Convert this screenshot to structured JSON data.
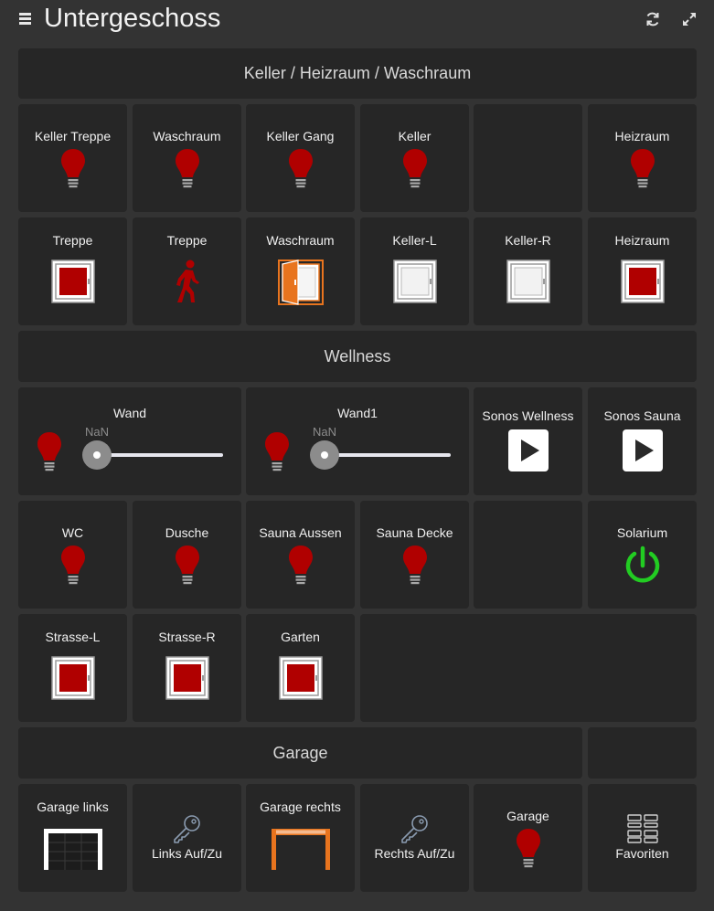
{
  "header": {
    "title": "Untergeschoss",
    "menu_icon": "hamburger-menu-icon",
    "refresh_icon": "refresh-icon",
    "fullscreen_icon": "fullscreen-icon"
  },
  "sections": {
    "keller": "Keller / Heizraum / Waschraum",
    "wellness": "Wellness",
    "garage": "Garage"
  },
  "lights_row1": [
    "Keller Treppe",
    "Waschraum",
    "Keller Gang",
    "Keller",
    "Heizraum"
  ],
  "windows_row2": {
    "treppe_window": "Treppe",
    "treppe_motion": "Treppe",
    "waschraum_door": "Waschraum",
    "keller_l": "Keller-L",
    "keller_r": "Keller-R",
    "heizraum": "Heizraum"
  },
  "wellness_dimmers": [
    {
      "label": "Wand",
      "value": "NaN"
    },
    {
      "label": "Wand1",
      "value": "NaN"
    }
  ],
  "sonos": [
    "Sonos Wellness",
    "Sonos Sauna"
  ],
  "wellness_lights": [
    "WC",
    "Dusche",
    "Sauna Aussen",
    "Sauna Decke"
  ],
  "solarium": "Solarium",
  "wellness_windows": [
    "Strasse-L",
    "Strasse-R",
    "Garten"
  ],
  "garage_tiles": {
    "garage_links": "Garage links",
    "links_auf_zu": "Links Auf/Zu",
    "garage_rechts": "Garage rechts",
    "rechts_auf_zu": "Rechts Auf/Zu",
    "garage_light": "Garage",
    "favoriten": "Favoriten"
  },
  "colors": {
    "background": "#333333",
    "tile": "#262626",
    "bulb_red": "#b00000",
    "window_closed_red": "#b00000",
    "door_open_orange": "#e8741e",
    "power_on_green": "#22cc22",
    "icon_gray": "#8a9bb0"
  }
}
